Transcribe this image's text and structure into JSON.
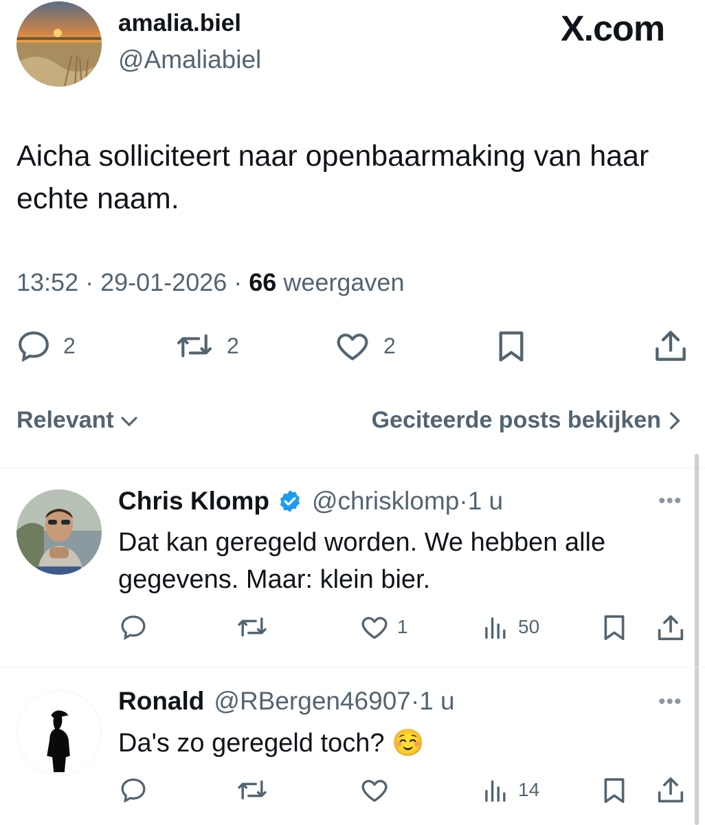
{
  "tweet": {
    "author_name": "amalia.biel",
    "author_handle": "@Amaliabiel",
    "brand": "X.com",
    "text": "Aicha solliciteert naar openbaarmaking van haar echte naam.",
    "time": "13:52",
    "date": "29-01-2026",
    "views_count": "66",
    "views_label": "weergaven",
    "reply_count": "2",
    "repost_count": "2",
    "like_count": "2"
  },
  "filters": {
    "sort_label": "Relevant",
    "quotes_label": "Geciteerde posts bekijken"
  },
  "replies": [
    {
      "name": "Chris Klomp",
      "handle": "@chrisklomp",
      "age": "1 u",
      "text": "Dat kan geregeld worden. We hebben alle gegevens. Maar: klein bier.",
      "likes": "1",
      "views": "50",
      "verified": true
    },
    {
      "name": "Ronald",
      "handle": "@RBergen46907",
      "age": "1 u",
      "text": "Da's zo geregeld toch? ☺️",
      "likes": "",
      "views": "14",
      "verified": false
    }
  ],
  "colors": {
    "text": "#0f1419",
    "secondary": "#536471",
    "verified_badge": "#1d9bf0",
    "divider": "#eff3f4"
  },
  "icons": [
    "reply-icon",
    "repost-icon",
    "like-icon",
    "bookmark-icon",
    "share-icon",
    "views-icon",
    "verified-badge-icon",
    "more-icon",
    "chevron-down-icon",
    "chevron-right-icon"
  ]
}
